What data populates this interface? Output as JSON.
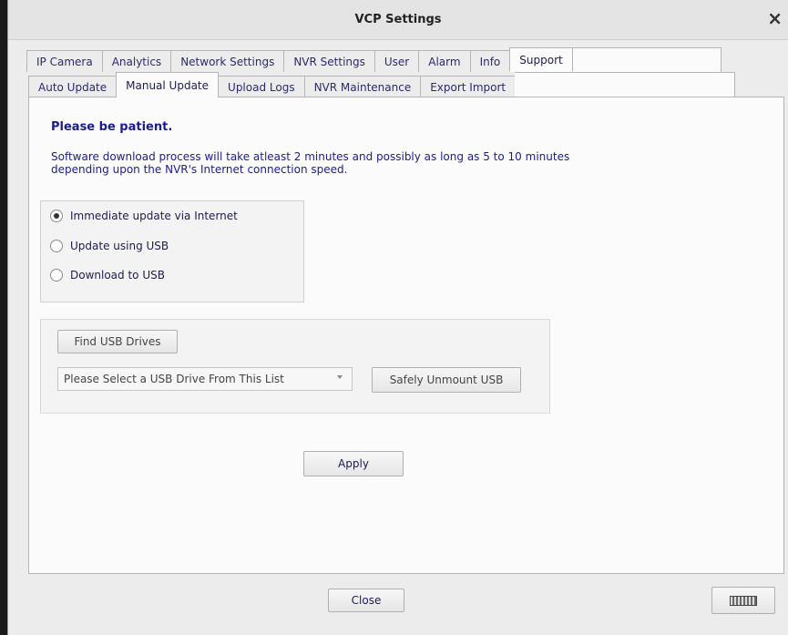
{
  "window": {
    "title": "VCP Settings"
  },
  "tabs_main": [
    "IP Camera",
    "Analytics",
    "Network Settings",
    "NVR Settings",
    "User",
    "Alarm",
    "Info",
    "Support"
  ],
  "tabs_sub": [
    "Auto Update",
    "Manual Update",
    "Upload Logs",
    "NVR Maintenance",
    "Export Import"
  ],
  "notice": {
    "title": "Please be patient.",
    "line1": "Software download process will take atleast 2 minutes and possibly as long as 5 to 10 minutes",
    "line2": "depending upon the NVR's Internet connection speed."
  },
  "options": {
    "immediate": "Immediate update via Internet",
    "usb_update": "Update using USB",
    "download_usb": "Download to USB",
    "selected": "immediate"
  },
  "usb": {
    "find_label": "Find USB Drives",
    "select_value": "Please Select a USB Drive From This List",
    "unmount_label": "Safely Unmount USB"
  },
  "actions": {
    "apply": "Apply",
    "close": "Close"
  },
  "icons": {
    "close": "close-icon",
    "keyboard": "keyboard-icon",
    "dropdown": "chevron-down-icon"
  }
}
